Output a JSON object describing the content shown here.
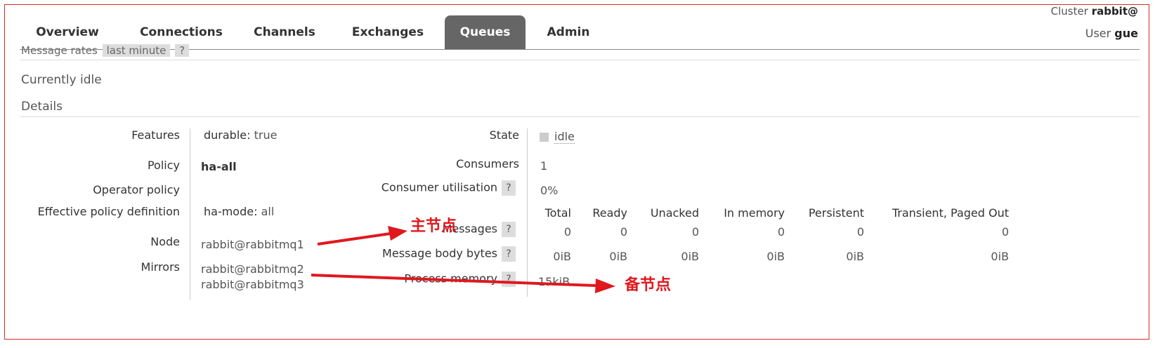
{
  "header": {
    "cluster_label": "Cluster",
    "cluster_value": "rabbit@",
    "user_label": "User",
    "user_value": "gue"
  },
  "tabs": [
    {
      "label": "Overview"
    },
    {
      "label": "Connections"
    },
    {
      "label": "Channels"
    },
    {
      "label": "Exchanges"
    },
    {
      "label": "Queues"
    },
    {
      "label": "Admin"
    }
  ],
  "active_tab": "Queues",
  "rates": {
    "label": "Message rates",
    "period": "last minute",
    "help": "?"
  },
  "status": "Currently idle",
  "details_title": "Details",
  "details": {
    "features_label": "Features",
    "features_key": "durable:",
    "features_value": "true",
    "policy_label": "Policy",
    "policy_value": "ha-all",
    "operator_policy_label": "Operator policy",
    "effective_label": "Effective policy definition",
    "effective_key": "ha-mode:",
    "effective_value": "all",
    "node_label": "Node",
    "node_value": "rabbit@rabbitmq1",
    "mirrors_label": "Mirrors",
    "mirrors": [
      "rabbit@rabbitmq2",
      "rabbit@rabbitmq3"
    ]
  },
  "state": {
    "state_label": "State",
    "state_value": "idle",
    "consumers_label": "Consumers",
    "consumers_value": "1",
    "utilisation_label": "Consumer utilisation",
    "utilisation_value": "0%",
    "messages_label": "Messages",
    "body_bytes_label": "Message body bytes",
    "process_memory_label": "Process memory",
    "process_memory_value": "15kiB",
    "help": "?"
  },
  "stats": {
    "columns": [
      "Total",
      "Ready",
      "Unacked",
      "In memory",
      "Persistent",
      "Transient, Paged Out"
    ],
    "messages": [
      "0",
      "0",
      "0",
      "0",
      "0",
      "0"
    ],
    "body_bytes": [
      "0iB",
      "0iB",
      "0iB",
      "0iB",
      "0iB",
      "0iB"
    ]
  },
  "annotations": {
    "primary": "主节点",
    "backup": "备节点",
    "color": "#e0181f"
  },
  "colors": {
    "frame": "#d82a2a",
    "active_tab_bg": "#666666"
  }
}
